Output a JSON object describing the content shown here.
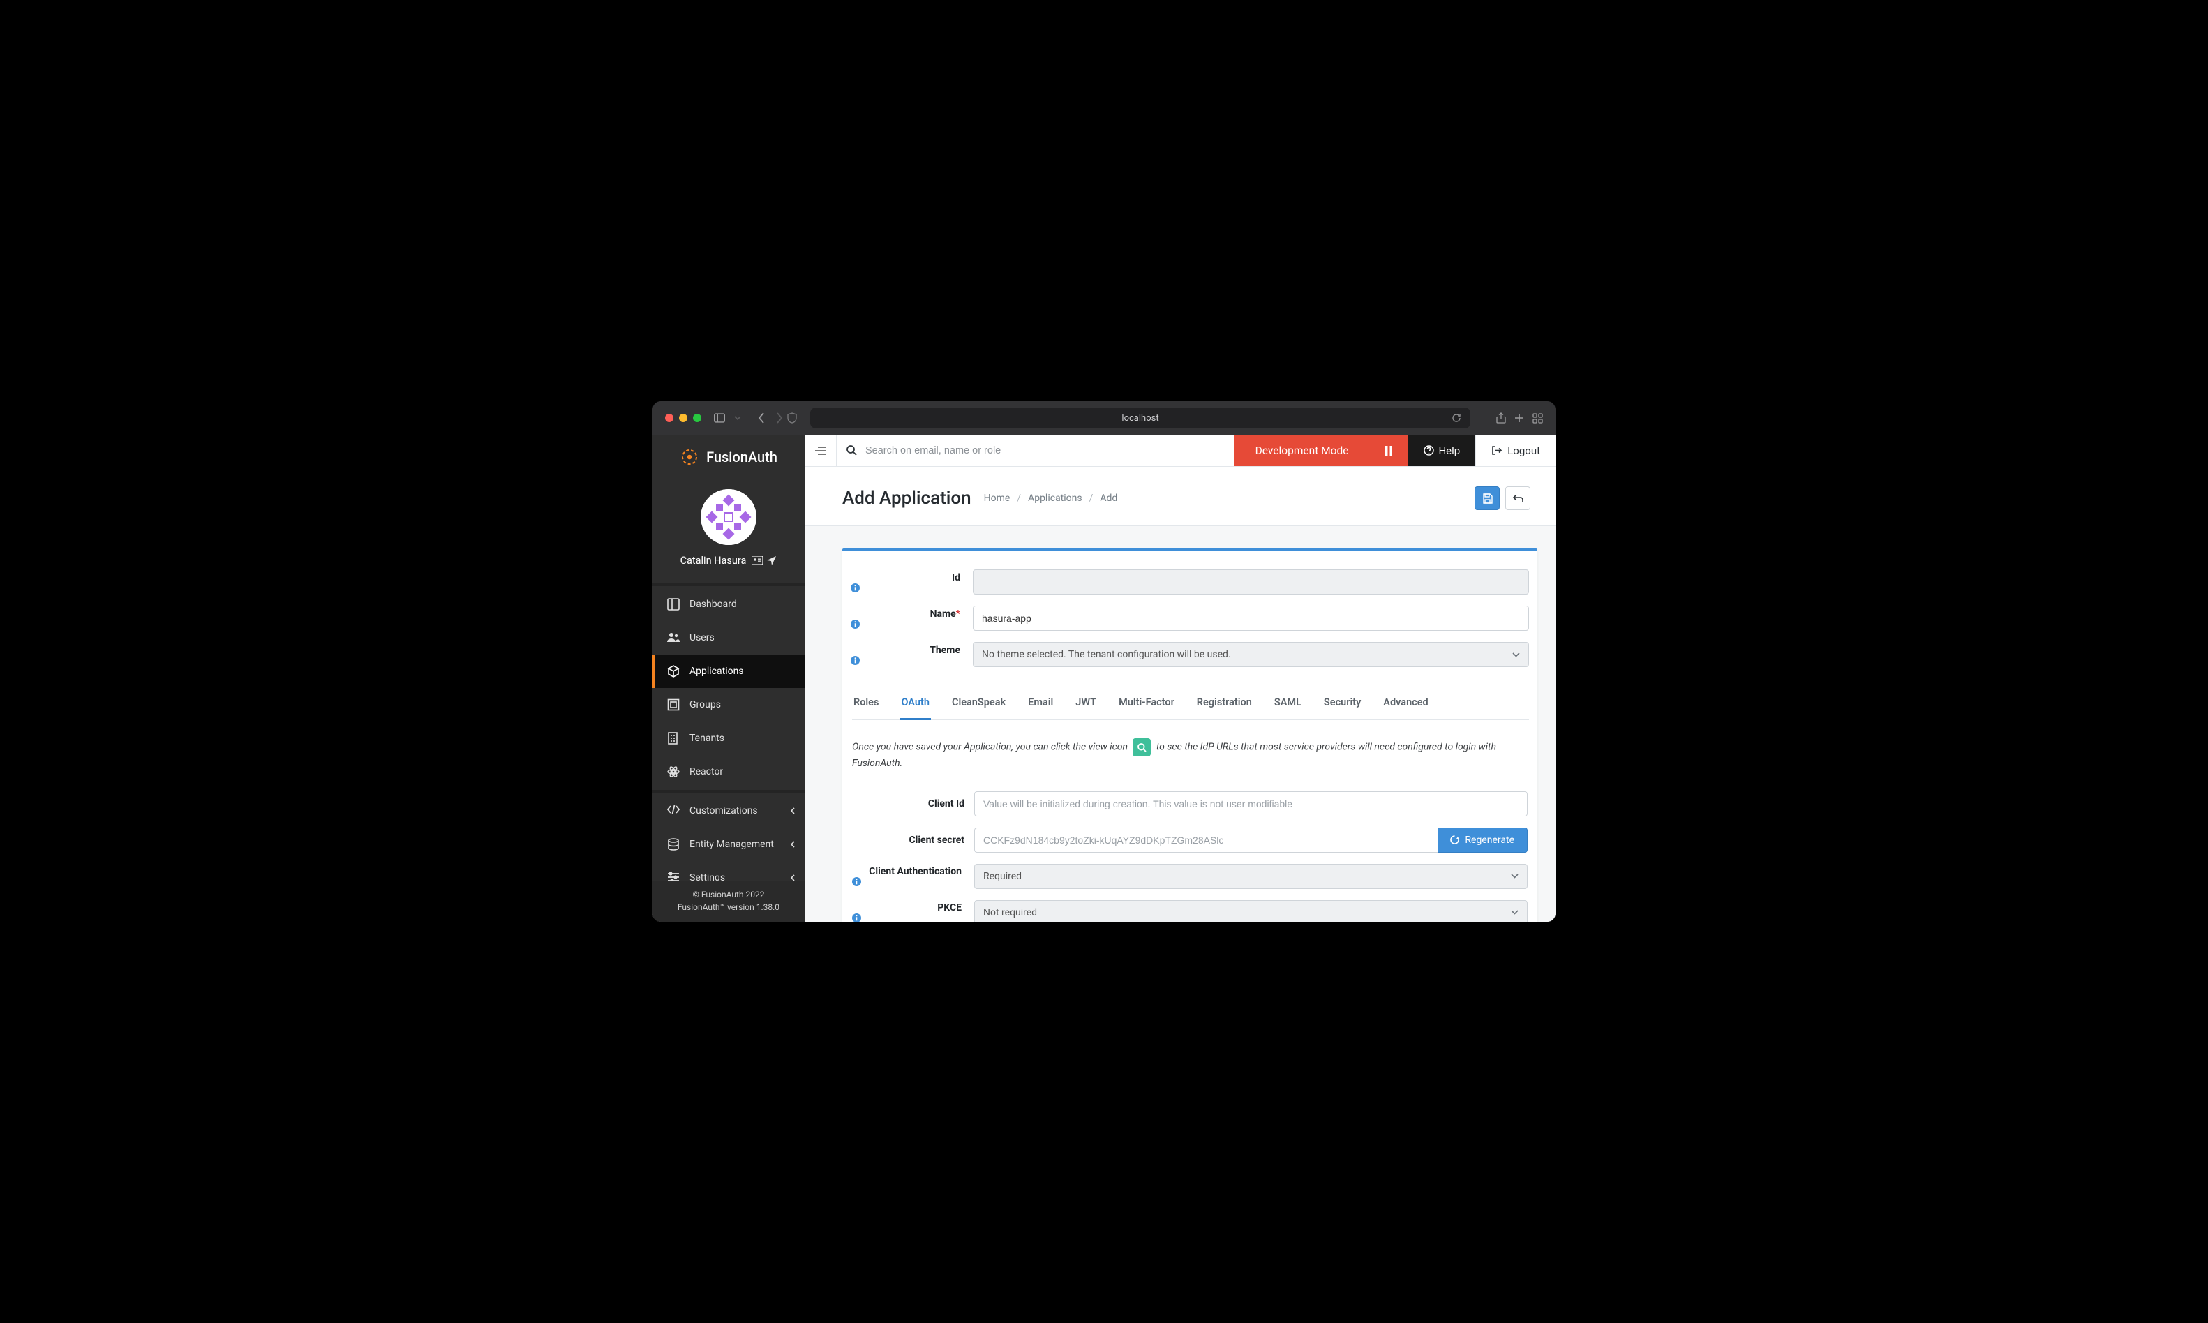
{
  "browser": {
    "url": "localhost"
  },
  "brand": {
    "name": "FusionAuth"
  },
  "profile": {
    "username": "Catalin Hasura"
  },
  "sidebar": {
    "items": [
      {
        "label": "Dashboard"
      },
      {
        "label": "Users"
      },
      {
        "label": "Applications"
      },
      {
        "label": "Groups"
      },
      {
        "label": "Tenants"
      },
      {
        "label": "Reactor"
      },
      {
        "label": "Customizations"
      },
      {
        "label": "Entity Management"
      },
      {
        "label": "Settings"
      }
    ]
  },
  "footer": {
    "copyright": "© FusionAuth 2022",
    "version": "FusionAuth™ version 1.38.0"
  },
  "topbar": {
    "search_placeholder": "Search on email, name or role",
    "mode": "Development Mode",
    "help": "Help",
    "logout": "Logout"
  },
  "header": {
    "title": "Add Application",
    "crumbs": [
      "Home",
      "Applications",
      "Add"
    ]
  },
  "form": {
    "id_label": "Id",
    "name_label": "Name",
    "name_value": "hasura-app",
    "theme_label": "Theme",
    "theme_value": "No theme selected. The tenant configuration will be used."
  },
  "tabs": [
    "Roles",
    "OAuth",
    "CleanSpeak",
    "Email",
    "JWT",
    "Multi-Factor",
    "Registration",
    "SAML",
    "Security",
    "Advanced"
  ],
  "active_tab": "OAuth",
  "oauth": {
    "info_before": "Once you have saved your Application, you can click the view icon",
    "info_after": "to see the IdP URLs that most service providers will need configured to login with FusionAuth.",
    "client_id_label": "Client Id",
    "client_id_placeholder": "Value will be initialized during creation. This value is not user modifiable",
    "client_secret_label": "Client secret",
    "client_secret_placeholder": "CCKFz9dN184cb9y2toZki-kUqAYZ9dDKpTZGm28ASlc",
    "regenerate": "Regenerate",
    "client_auth_label": "Client Authentication",
    "client_auth_value": "Required",
    "pkce_label": "PKCE",
    "pkce_value": "Not required"
  }
}
